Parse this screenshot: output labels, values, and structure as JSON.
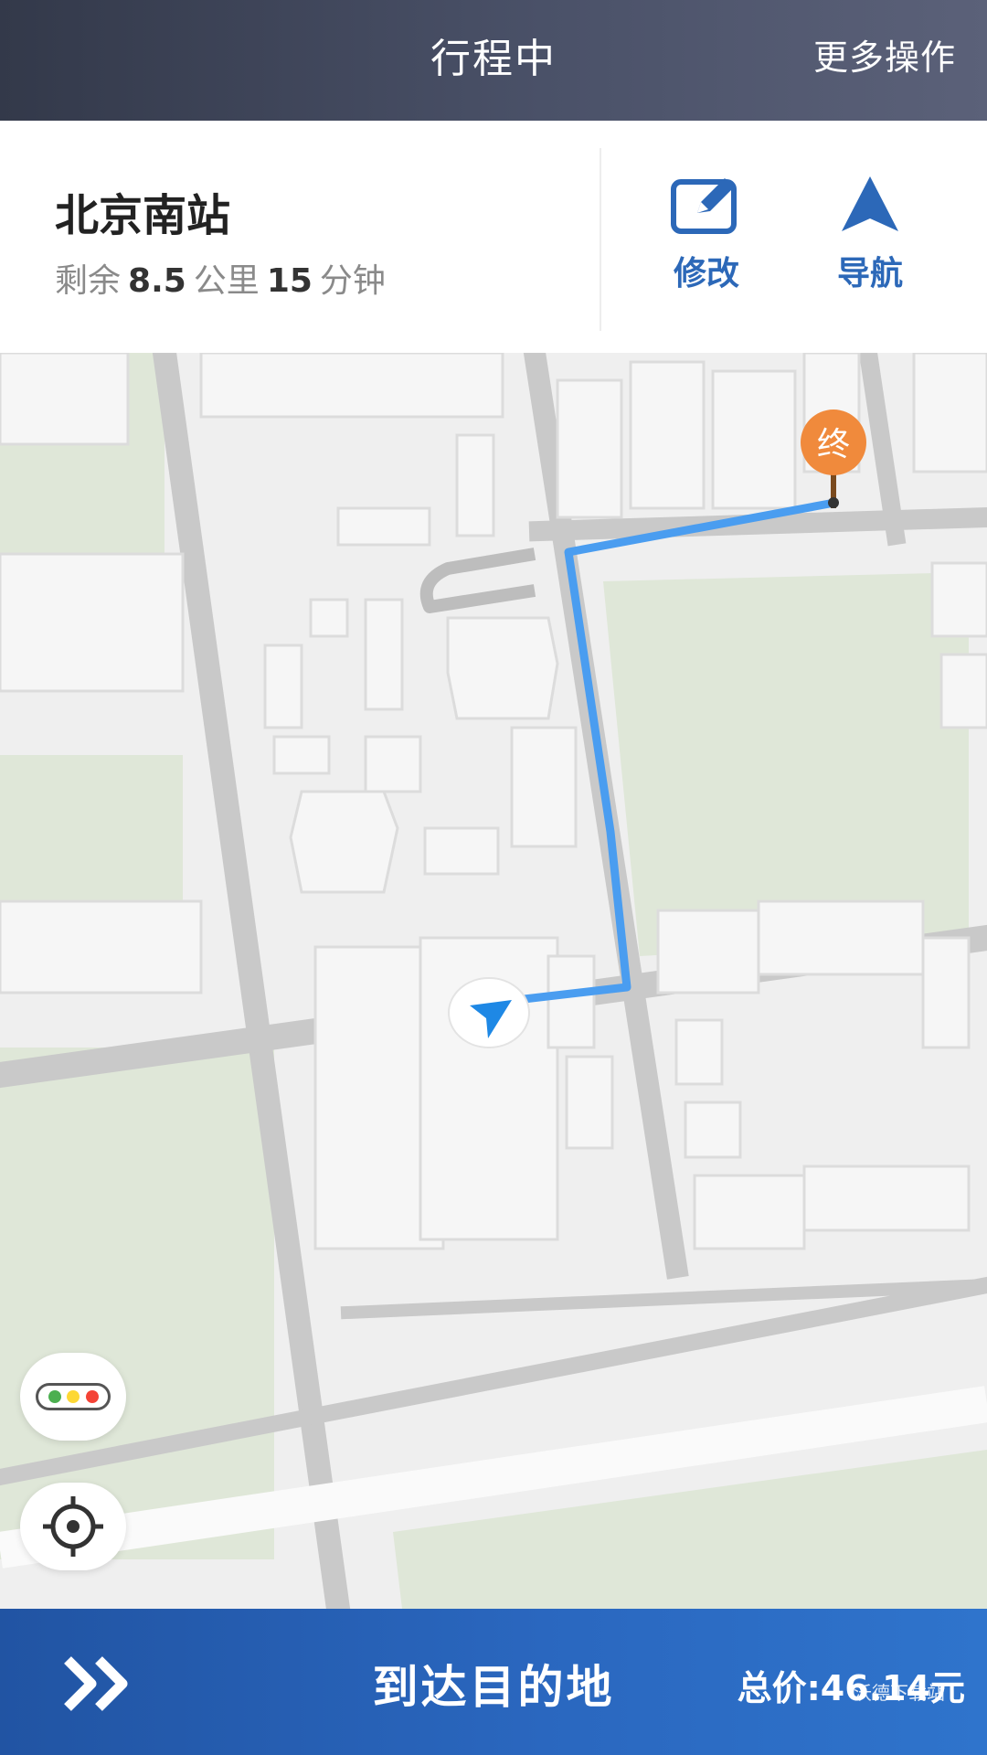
{
  "header": {
    "title": "行程中",
    "more_label": "更多操作"
  },
  "trip": {
    "destination": "北京南站",
    "remaining_prefix": "剩余",
    "distance_value": "8.5",
    "distance_unit": "公里",
    "time_value": "15",
    "time_unit": "分钟"
  },
  "actions": {
    "edit_label": "修改",
    "navigate_label": "导航"
  },
  "map": {
    "destination_marker_label": "终",
    "route_color": "#4a9df0",
    "destination_marker_color": "#f08a3c",
    "current_location_color": "#1e88e5",
    "traffic_colors": [
      "#4caf50",
      "#fdd835",
      "#f44336"
    ]
  },
  "footer": {
    "arrive_label": "到达目的地",
    "price_label": "总价:46.14元",
    "watermark": "沃德下载站"
  },
  "icons": {
    "header": [],
    "actions": [
      "edit-icon",
      "navigate-arrow-icon"
    ],
    "map": [
      "destination-pin-icon",
      "current-location-icon",
      "traffic-light-icon",
      "locate-icon"
    ],
    "footer": [
      "double-chevron-icon"
    ]
  }
}
